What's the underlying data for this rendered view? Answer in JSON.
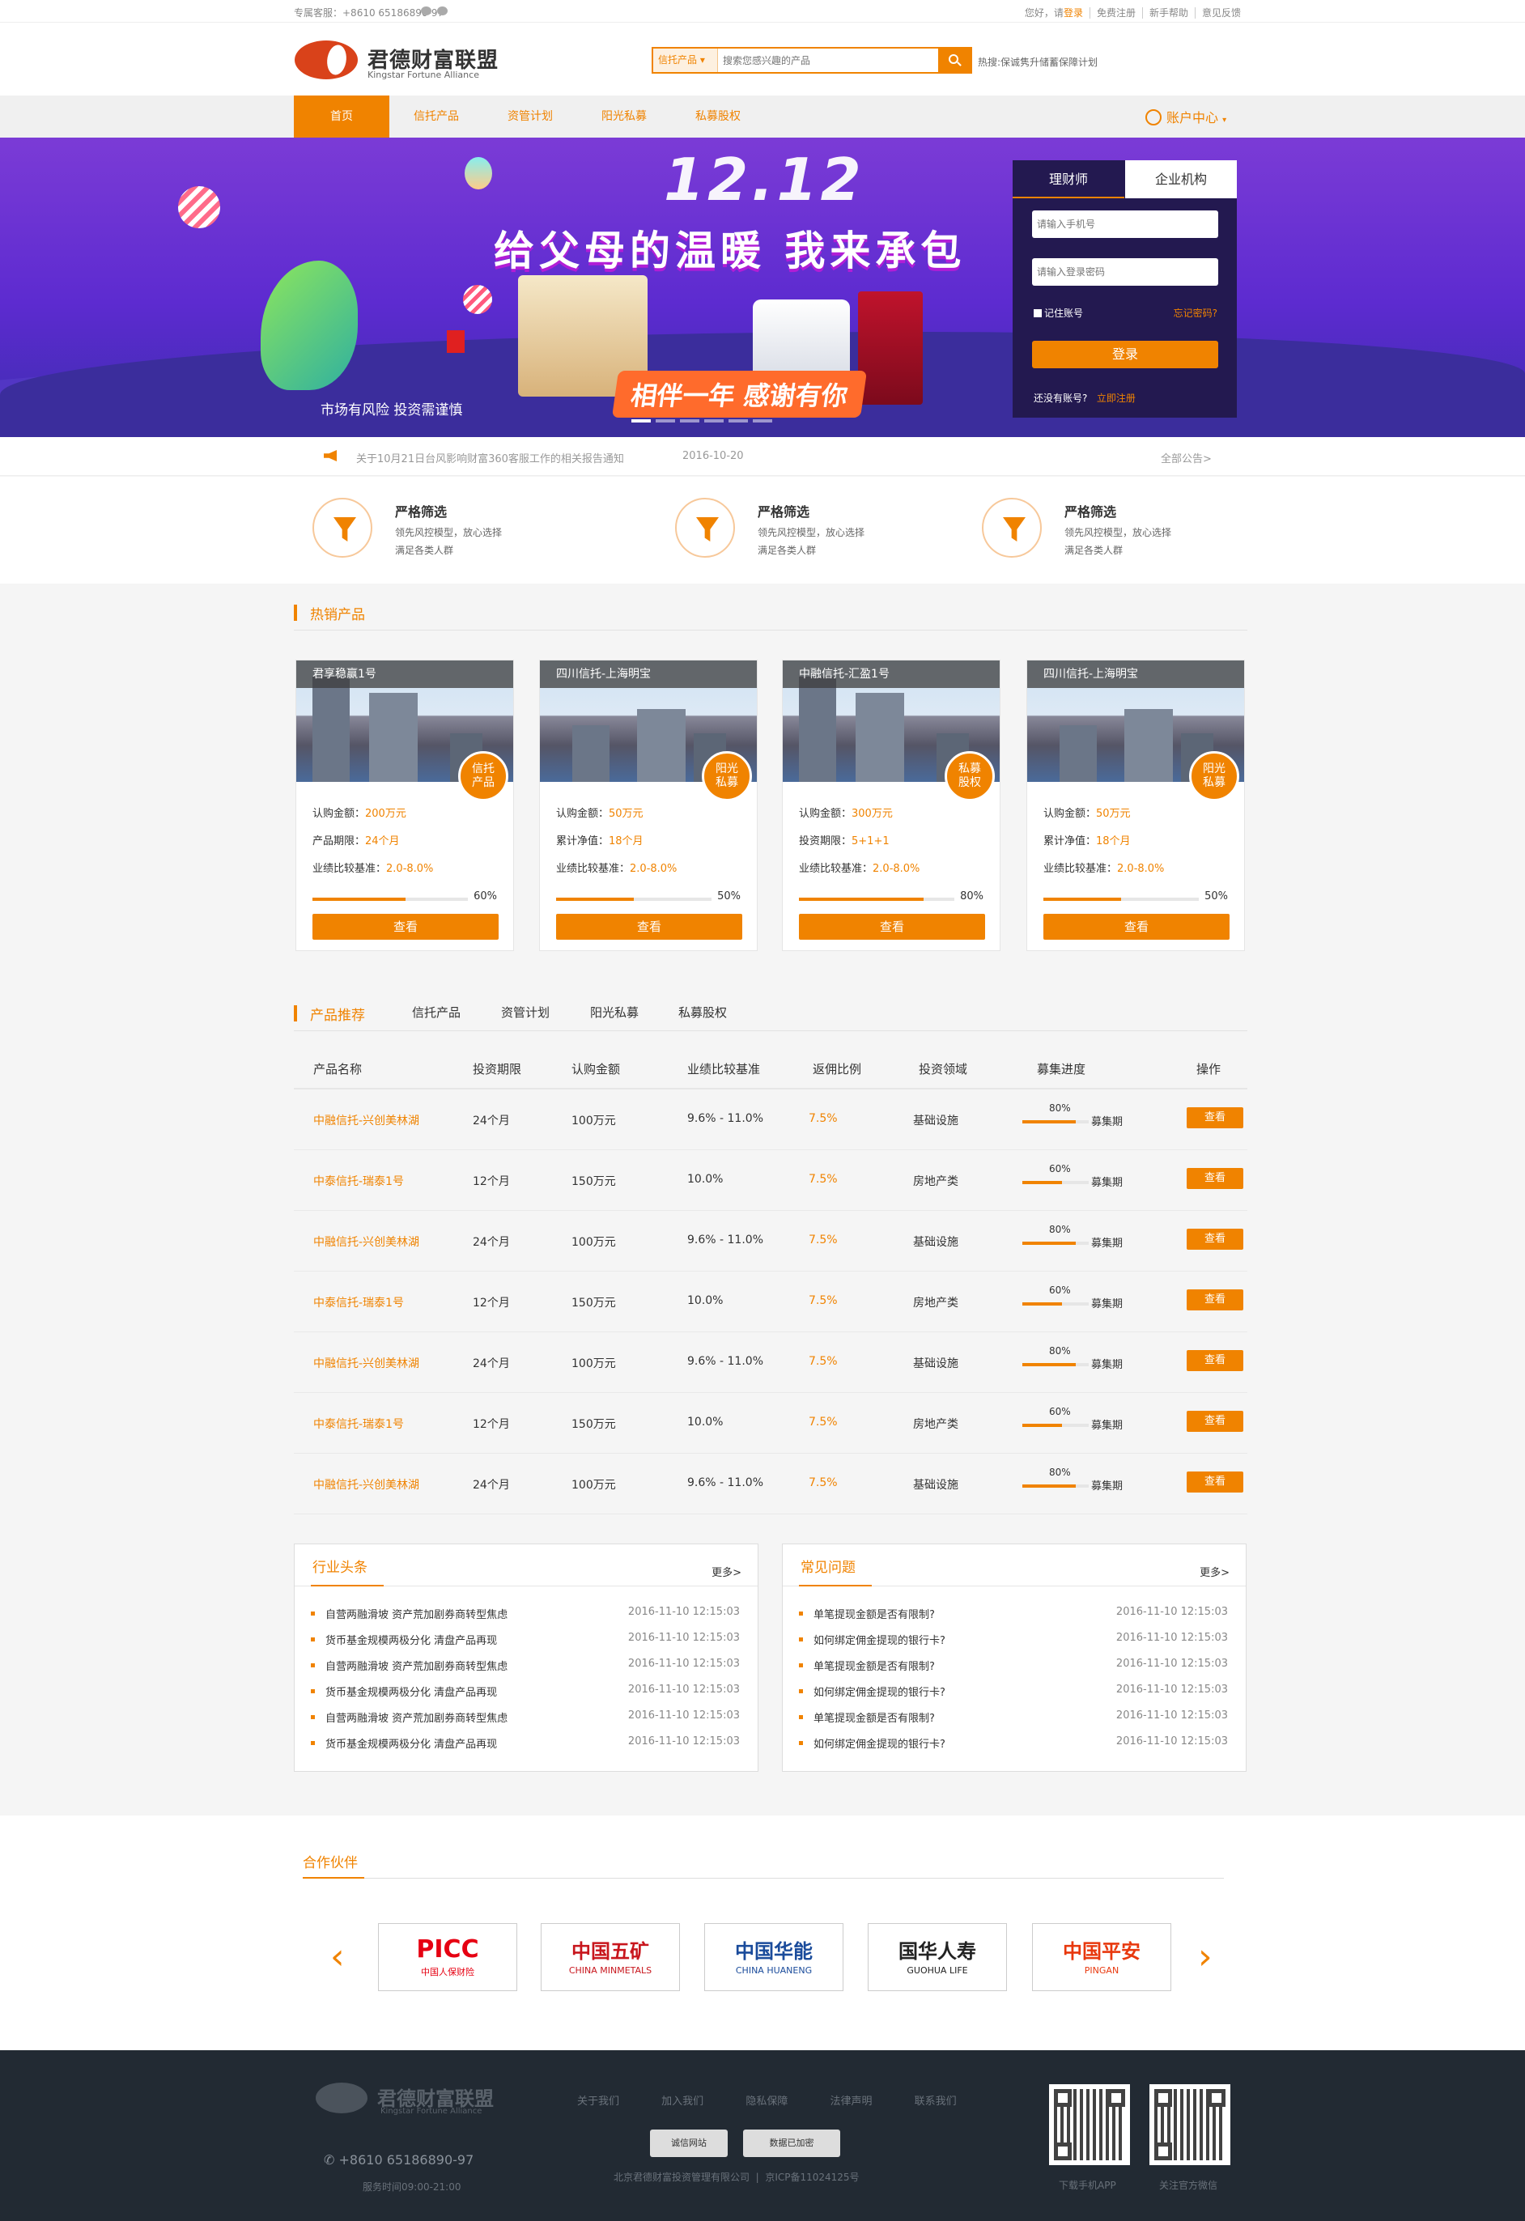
{
  "topbar": {
    "hotline": "专属客服：+8610 65186890-97",
    "greeting": "您好，请",
    "login": "登录",
    "register": "免费注册",
    "help": "新手帮助",
    "feedback": "意见反馈"
  },
  "header": {
    "logo_cn": "君德财富联盟",
    "logo_en": "Kingstar Fortune Alliance",
    "search_select": "信托产品",
    "search_placeholder": "搜索您感兴趣的产品",
    "hot_words": "热搜:保诚隽升储蓄保障计划"
  },
  "nav": {
    "items": [
      "首页",
      "信托产品",
      "资管计划",
      "阳光私募",
      "私募股权"
    ],
    "account": "账户中心"
  },
  "banner": {
    "date_text": "12.12",
    "headline": "给父母的温暖 我来承包",
    "subline": "相伴一年 感谢有你",
    "risk": "市场有风险  投资需谨慎"
  },
  "login": {
    "tab_advisor": "理财师",
    "tab_org": "企业机构",
    "phone_placeholder": "请输入手机号",
    "password_placeholder": "请输入登录密码",
    "remember": "记住账号",
    "forgot": "忘记密码?",
    "submit": "登录",
    "no_account": "还没有账号?",
    "register_now": "立即注册"
  },
  "notice": {
    "text": "关于10月21日台风影响财富360客服工作的相关报告通知",
    "date": "2016-10-20",
    "all": "全部公告>"
  },
  "features": [
    {
      "title": "严格筛选",
      "line1": "领先风控模型，放心选择",
      "line2": "满足各类人群"
    },
    {
      "title": "严格筛选",
      "line1": "领先风控模型，放心选择",
      "line2": "满足各类人群"
    },
    {
      "title": "严格筛选",
      "line1": "领先风控模型，放心选择",
      "line2": "满足各类人群"
    }
  ],
  "hot": {
    "title": "热销产品",
    "cards": [
      {
        "name": "君享稳赢1号",
        "badge1": "信托",
        "badge2": "产品",
        "l1k": "认购金额：",
        "l1v": "200万元",
        "l2k": "产品期限：",
        "l2v": "24个月",
        "l3k": "业绩比较基准：",
        "l3v": "2.0-8.0%",
        "pct": "60%",
        "progress": 0.6,
        "btn": "查看"
      },
      {
        "name": "四川信托-上海明宝",
        "badge1": "阳光",
        "badge2": "私募",
        "l1k": "认购金额：",
        "l1v": "50万元",
        "l2k": "累计净值：",
        "l2v": "18个月",
        "l3k": "业绩比较基准：",
        "l3v": "2.0-8.0%",
        "pct": "50%",
        "progress": 0.5,
        "btn": "查看"
      },
      {
        "name": "中融信托-汇盈1号",
        "badge1": "私募",
        "badge2": "股权",
        "l1k": "认购金额：",
        "l1v": "300万元",
        "l2k": "投资期限：",
        "l2v": "5+1+1",
        "l3k": "业绩比较基准：",
        "l3v": "2.0-8.0%",
        "pct": "80%",
        "progress": 0.8,
        "btn": "查看"
      },
      {
        "name": "四川信托-上海明宝",
        "badge1": "阳光",
        "badge2": "私募",
        "l1k": "认购金额：",
        "l1v": "50万元",
        "l2k": "累计净值：",
        "l2v": "18个月",
        "l3k": "业绩比较基准：",
        "l3v": "2.0-8.0%",
        "pct": "50%",
        "progress": 0.5,
        "btn": "查看"
      }
    ]
  },
  "recommend": {
    "title": "产品推荐",
    "tabs": [
      "信托产品",
      "资管计划",
      "阳光私募",
      "私募股权"
    ],
    "headers": [
      "产品名称",
      "投资期限",
      "认购金额",
      "业绩比较基准",
      "返佣比例",
      "投资领域",
      "募集进度",
      "操作"
    ],
    "rows": [
      {
        "name": "中融信托-兴创美林湖",
        "term": "24个月",
        "amount": "100万元",
        "yield": "9.6% - 11.0%",
        "rebate": "7.5%",
        "field": "基础设施",
        "pct": "80%",
        "progress": 0.8,
        "status": "募集期",
        "op": "查看"
      },
      {
        "name": "中泰信托-瑞泰1号",
        "term": "12个月",
        "amount": "150万元",
        "yield": "10.0%",
        "rebate": "7.5%",
        "field": "房地产类",
        "pct": "60%",
        "progress": 0.6,
        "status": "募集期",
        "op": "查看"
      },
      {
        "name": "中融信托-兴创美林湖",
        "term": "24个月",
        "amount": "100万元",
        "yield": "9.6% - 11.0%",
        "rebate": "7.5%",
        "field": "基础设施",
        "pct": "80%",
        "progress": 0.8,
        "status": "募集期",
        "op": "查看"
      },
      {
        "name": "中泰信托-瑞泰1号",
        "term": "12个月",
        "amount": "150万元",
        "yield": "10.0%",
        "rebate": "7.5%",
        "field": "房地产类",
        "pct": "60%",
        "progress": 0.6,
        "status": "募集期",
        "op": "查看"
      },
      {
        "name": "中融信托-兴创美林湖",
        "term": "24个月",
        "amount": "100万元",
        "yield": "9.6% - 11.0%",
        "rebate": "7.5%",
        "field": "基础设施",
        "pct": "80%",
        "progress": 0.8,
        "status": "募集期",
        "op": "查看"
      },
      {
        "name": "中泰信托-瑞泰1号",
        "term": "12个月",
        "amount": "150万元",
        "yield": "10.0%",
        "rebate": "7.5%",
        "field": "房地产类",
        "pct": "60%",
        "progress": 0.6,
        "status": "募集期",
        "op": "查看"
      },
      {
        "name": "中融信托-兴创美林湖",
        "term": "24个月",
        "amount": "100万元",
        "yield": "9.6% - 11.0%",
        "rebate": "7.5%",
        "field": "基础设施",
        "pct": "80%",
        "progress": 0.8,
        "status": "募集期",
        "op": "查看"
      }
    ]
  },
  "news": {
    "title": "行业头条",
    "more": "更多>",
    "items": [
      {
        "t": "自营两融滑坡 资产荒加剧券商转型焦虑",
        "d": "2016-11-10 12:15:03"
      },
      {
        "t": "货币基金规模两极分化 清盘产品再现",
        "d": "2016-11-10 12:15:03"
      },
      {
        "t": "自营两融滑坡 资产荒加剧券商转型焦虑",
        "d": "2016-11-10 12:15:03"
      },
      {
        "t": "货币基金规模两极分化 清盘产品再现",
        "d": "2016-11-10 12:15:03"
      },
      {
        "t": "自营两融滑坡 资产荒加剧券商转型焦虑",
        "d": "2016-11-10 12:15:03"
      },
      {
        "t": "货币基金规模两极分化 清盘产品再现",
        "d": "2016-11-10 12:15:03"
      }
    ]
  },
  "faq": {
    "title": "常见问题",
    "more": "更多>",
    "items": [
      {
        "t": "单笔提现金额是否有限制?",
        "d": "2016-11-10 12:15:03"
      },
      {
        "t": "如何绑定佣金提现的银行卡?",
        "d": "2016-11-10 12:15:03"
      },
      {
        "t": "单笔提现金额是否有限制?",
        "d": "2016-11-10 12:15:03"
      },
      {
        "t": "如何绑定佣金提现的银行卡?",
        "d": "2016-11-10 12:15:03"
      },
      {
        "t": "单笔提现金额是否有限制?",
        "d": "2016-11-10 12:15:03"
      },
      {
        "t": "如何绑定佣金提现的银行卡?",
        "d": "2016-11-10 12:15:03"
      }
    ]
  },
  "partners": {
    "title": "合作伙伴",
    "logos": [
      {
        "main": "PICC",
        "sub": "中国人保财险",
        "color": "#e60012"
      },
      {
        "main": "中国五矿",
        "sub": "CHINA MINMETALS",
        "color": "#c8161d"
      },
      {
        "main": "中国华能",
        "sub": "CHINA HUANENG",
        "color": "#1a4b9b"
      },
      {
        "main": "国华人寿",
        "sub": "GUOHUA LIFE",
        "color": "#222222"
      },
      {
        "main": "中国平安",
        "sub": "PINGAN",
        "color": "#e8380d"
      }
    ]
  },
  "footer": {
    "logo_cn": "君德财富联盟",
    "logo_en": "Kingstar Fortune Alliance",
    "links": [
      "关于我们",
      "加入我们",
      "隐私保障",
      "法律声明",
      "联系我们"
    ],
    "badge1": "诚信网站",
    "badge2": "数据已加密",
    "phone": "+8610 65186890-97",
    "hours": "服务时间09:00-21:00",
    "copyright": "北京君德财富投资管理有限公司",
    "icp": "京ICP备11024125号",
    "qr1": "下载手机APP",
    "qr2": "关注官方微信"
  },
  "colors": {
    "accent": "#f08300",
    "footer_bg": "#222a33",
    "banner_bg": "#5d2bd0"
  }
}
